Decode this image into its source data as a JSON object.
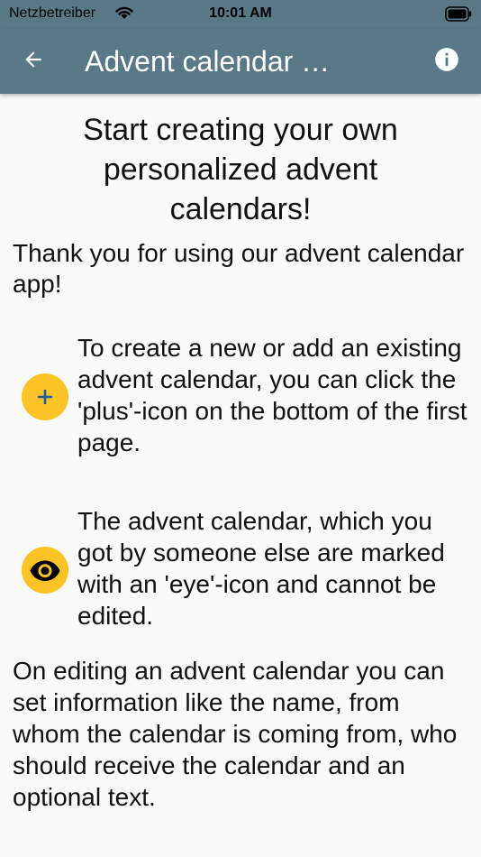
{
  "status_bar": {
    "carrier": "Netzbetreiber",
    "time": "10:01 AM",
    "wifi_icon": "wifi-icon",
    "battery_icon": "battery-icon"
  },
  "app_bar": {
    "title": "Advent calendar …",
    "back_icon": "arrow-left-icon",
    "info_icon": "info-icon",
    "color": "#5a7988"
  },
  "main": {
    "headline": "Start creating your own personalized advent calendars!",
    "intro": "Thank you for using our advent calendar app!",
    "features": [
      {
        "icon": "plus-icon",
        "text": "To create a new or add an existing advent calendar, you can click the 'plus'-icon on the bottom of the first page."
      },
      {
        "icon": "eye-icon",
        "text": "The advent calendar, which you got by someone else are marked with an 'eye'-icon and cannot be edited."
      }
    ],
    "outro": "On editing an advent calendar you can set information like the name, from whom the calendar is coming from, who should receive the calendar and an optional text.",
    "accent_color": "#fbc325"
  }
}
